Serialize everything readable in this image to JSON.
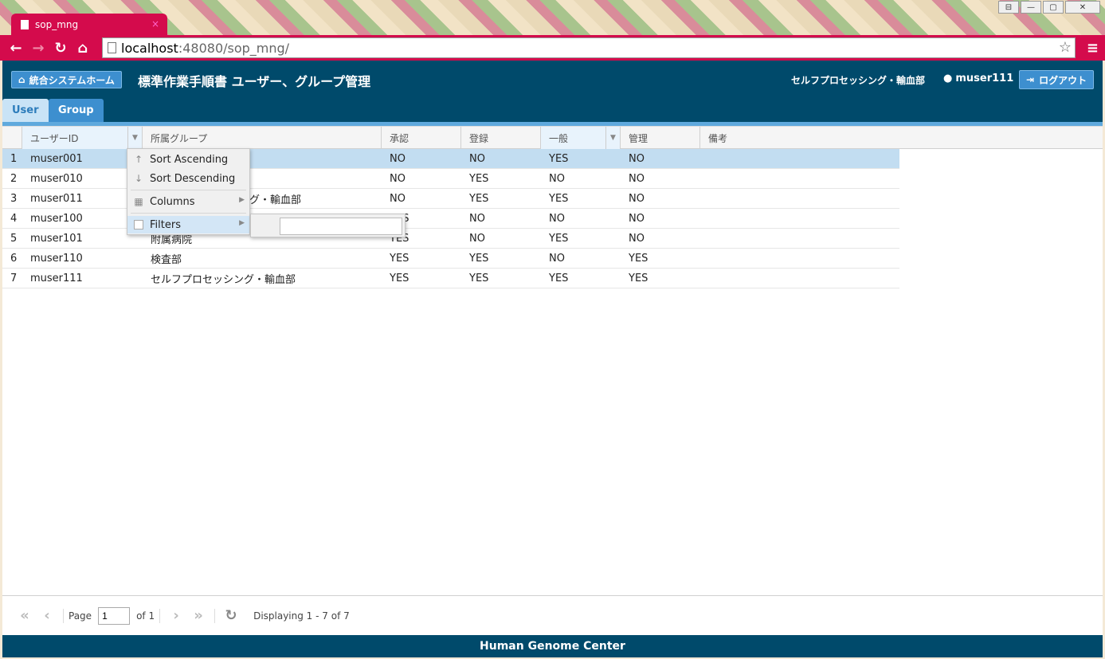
{
  "browser": {
    "tab_title": "sop_mng",
    "tab_close": "×",
    "url_host": "localhost",
    "url_rest": ":48080/sop_mng/",
    "controls": [
      "⊟",
      "—",
      "▢",
      "✕"
    ]
  },
  "header": {
    "home_label": "統合システムホーム",
    "title": "標準作業手順書 ユーザー、グループ管理",
    "department": "セルフプロセッシング・輸血部",
    "user": "muser111",
    "logout_label": "ログアウト"
  },
  "tabs": [
    {
      "label": "User"
    },
    {
      "label": "Group"
    }
  ],
  "grid": {
    "columns": [
      "ユーザーID",
      "所属グループ",
      "承認",
      "登録",
      "一般",
      "管理",
      "備考"
    ],
    "rows": [
      {
        "num": "1",
        "id": "muser001",
        "group": "",
        "approve": "NO",
        "register": "NO",
        "general": "YES",
        "admin": "NO"
      },
      {
        "num": "2",
        "id": "muser010",
        "group": "",
        "approve": "NO",
        "register": "YES",
        "general": "NO",
        "admin": "NO"
      },
      {
        "num": "3",
        "id": "muser011",
        "group": "グ・輸血部",
        "approve": "NO",
        "register": "YES",
        "general": "YES",
        "admin": "NO"
      },
      {
        "num": "4",
        "id": "muser100",
        "group": "",
        "approve": "ES",
        "register": "NO",
        "general": "NO",
        "admin": "NO"
      },
      {
        "num": "5",
        "id": "muser101",
        "group": "附属病院",
        "approve": "YES",
        "register": "NO",
        "general": "YES",
        "admin": "NO"
      },
      {
        "num": "6",
        "id": "muser110",
        "group": "検査部",
        "approve": "YES",
        "register": "YES",
        "general": "NO",
        "admin": "YES"
      },
      {
        "num": "7",
        "id": "muser111",
        "group": "セルフプロセッシング・輸血部",
        "approve": "YES",
        "register": "YES",
        "general": "YES",
        "admin": "YES"
      }
    ]
  },
  "column_menu": {
    "sort_asc": "Sort Ascending",
    "sort_desc": "Sort Descending",
    "columns": "Columns",
    "filters": "Filters"
  },
  "pager": {
    "page_label": "Page",
    "page_value": "1",
    "of_label": "of 1",
    "display_text": "Displaying 1 - 7 of 7"
  },
  "footer": {
    "text": "Human Genome Center"
  }
}
